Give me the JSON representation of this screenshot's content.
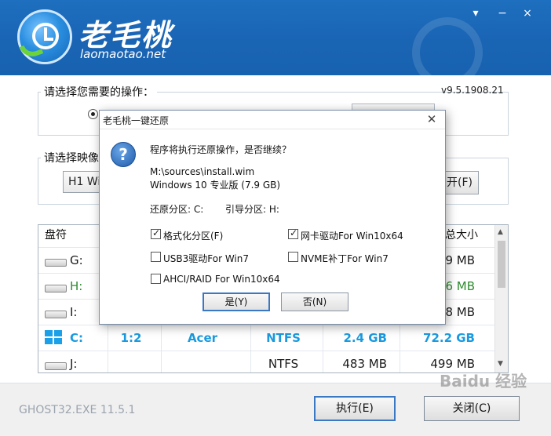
{
  "header": {
    "brand": "老毛桃",
    "url": "laomaotao.net",
    "window_controls": [
      "▾",
      "−",
      "×"
    ]
  },
  "main": {
    "operation_legend": "请选择您需要的操作：",
    "version": "v9.5.1908.21",
    "image_legend": "请选择映像",
    "image_combo_value": "H1 Wi",
    "open_button": "开(F)"
  },
  "table": {
    "headers": {
      "drive": "盘符",
      "total": "总大小"
    },
    "rows": [
      {
        "letter": "G:",
        "col2": "",
        "col3": "",
        "fs": "",
        "used": "",
        "total": "99 MB",
        "color": "#1a1a1a",
        "icon": "drive-icon"
      },
      {
        "letter": "H:",
        "col2": "",
        "col3": "",
        "fs": "",
        "used": "",
        "total": "96 MB",
        "color": "#2e8b2e",
        "icon": "drive-icon"
      },
      {
        "letter": "I:",
        "col2": "",
        "col3": "",
        "fs": "",
        "used": "",
        "total": "28 MB",
        "color": "#1a1a1a",
        "icon": "drive-icon"
      },
      {
        "letter": "C:",
        "col2": "1:2",
        "col3": "Acer",
        "fs": "NTFS",
        "used": "2.4 GB",
        "total": "72.2 GB",
        "color": "#1a9ae0",
        "icon": "windows-icon"
      },
      {
        "letter": "J:",
        "col2": "",
        "col3": "",
        "fs": "NTFS",
        "used": "483 MB",
        "total": "499 MB",
        "color": "#1a1a1a",
        "icon": "drive-icon"
      }
    ]
  },
  "footer": {
    "ghost_version": "GHOST32.EXE 11.5.1",
    "execute_button": "执行(E)",
    "close_button": "关闭(C)",
    "watermark": "Baidu 经验"
  },
  "dialog": {
    "title": "老毛桃一键还原",
    "close_glyph": "✕",
    "question": "程序将执行还原操作，是否继续？",
    "path": "M:\\sources\\install.wim",
    "edition": "Windows 10 专业版 (7.9 GB)",
    "restore_partition": "还原分区: C:",
    "boot_partition": "引导分区: H:",
    "options": {
      "format": {
        "label": "格式化分区(F)",
        "checked": true
      },
      "nic_driver": {
        "label": "网卡驱动For Win10x64",
        "checked": true
      },
      "usb3_driver": {
        "label": "USB3驱动For Win7",
        "checked": false
      },
      "nvme_patch": {
        "label": "NVME补丁For Win7",
        "checked": false
      },
      "ahci_raid": {
        "label": "AHCI/RAID For Win10x64",
        "checked": false
      }
    },
    "yes_button": "是(Y)",
    "no_button": "否(N)"
  },
  "colors": {
    "header_blue": "#1a64b4",
    "accent_blue": "#1a9ae0",
    "green": "#2e8b2e",
    "focus_border": "#3b78c4"
  }
}
